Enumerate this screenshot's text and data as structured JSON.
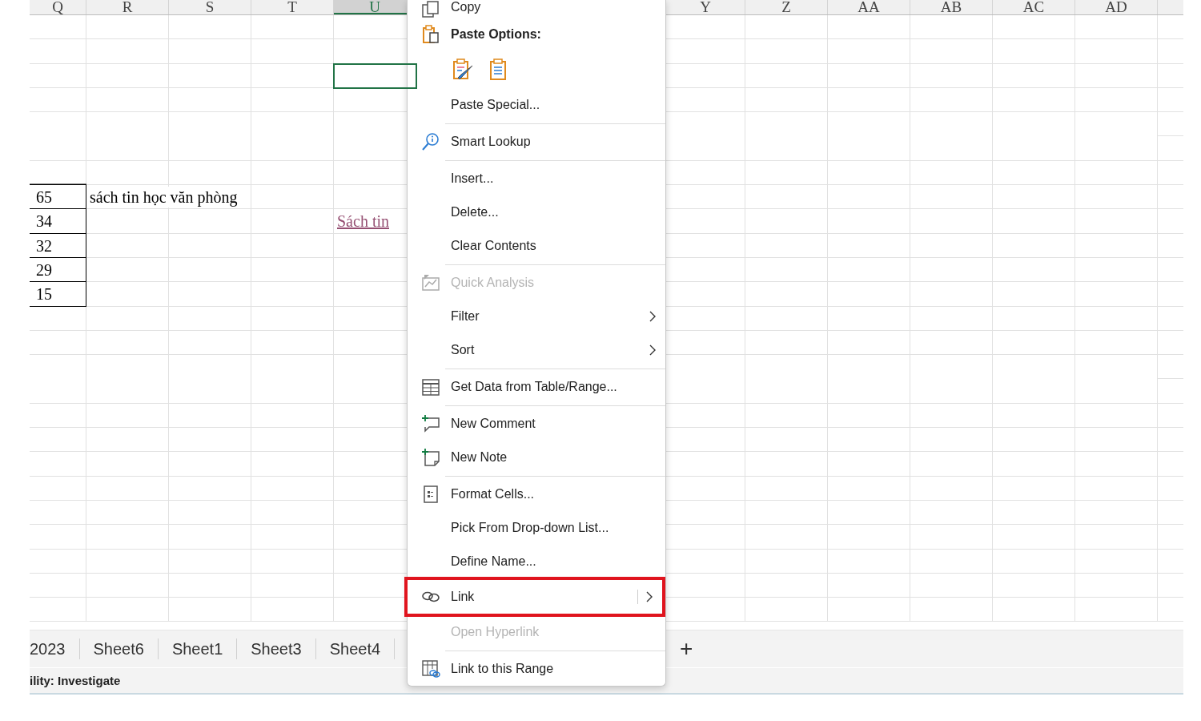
{
  "sheet": {
    "columns": [
      "Q",
      "R",
      "S",
      "T",
      "U",
      "Y",
      "Z",
      "AA",
      "AB",
      "AC",
      "AD"
    ],
    "rows": [
      {},
      {},
      {
        "cells": [
          null,
          null,
          null,
          null,
          {
            "kind": "plain",
            "selected": true
          }
        ]
      },
      {},
      {},
      {},
      {},
      {
        "cells": [
          {
            "kind": "bordered",
            "text": "65"
          },
          {
            "kind": "plain",
            "text": "sách tin học văn phòng"
          }
        ]
      },
      {
        "cells": [
          {
            "kind": "bordered",
            "text": "34"
          },
          null,
          null,
          null,
          {
            "kind": "plain",
            "text": "Sách tin",
            "link": true
          }
        ]
      },
      {
        "cells": [
          {
            "kind": "bordered",
            "text": "32"
          }
        ]
      },
      {
        "cells": [
          {
            "kind": "bordered",
            "text": "29"
          }
        ]
      },
      {
        "cells": [
          {
            "kind": "bordered",
            "text": "15"
          }
        ]
      },
      {},
      {},
      {},
      {},
      {},
      {},
      {},
      {},
      {},
      {},
      {},
      {},
      {}
    ]
  },
  "sheet_tabs": {
    "tabs": [
      "2023",
      "Sheet6",
      "Sheet1",
      "Sheet3",
      "Sheet4"
    ],
    "add_button": "+"
  },
  "status_bar": {
    "text": "ility: Investigate"
  },
  "context_menu": {
    "items": [
      {
        "kind": "command",
        "label": "Copy",
        "disabled": false
      },
      {
        "kind": "header",
        "label": "Paste Options:"
      },
      {
        "kind": "paste-icons"
      },
      {
        "kind": "command",
        "label": "Paste Special...",
        "disabled": false
      },
      {
        "kind": "separator"
      },
      {
        "kind": "command",
        "label": "Smart Lookup",
        "disabled": false
      },
      {
        "kind": "separator"
      },
      {
        "kind": "command",
        "label": "Insert...",
        "disabled": false
      },
      {
        "kind": "command",
        "label": "Delete...",
        "disabled": false
      },
      {
        "kind": "command",
        "label": "Clear Contents",
        "disabled": false
      },
      {
        "kind": "separator"
      },
      {
        "kind": "command",
        "label": "Quick Analysis",
        "disabled": true
      },
      {
        "kind": "submenu",
        "label": "Filter",
        "disabled": false,
        "highlighted": false
      },
      {
        "kind": "submenu",
        "label": "Sort",
        "disabled": false,
        "highlighted": false
      },
      {
        "kind": "separator"
      },
      {
        "kind": "command",
        "label": "Get Data from Table/Range...",
        "disabled": false
      },
      {
        "kind": "separator"
      },
      {
        "kind": "command",
        "label": "New Comment",
        "disabled": false
      },
      {
        "kind": "command",
        "label": "New Note",
        "disabled": false
      },
      {
        "kind": "separator"
      },
      {
        "kind": "command",
        "label": "Format Cells...",
        "disabled": false
      },
      {
        "kind": "command",
        "label": "Pick From Drop-down List...",
        "disabled": false
      },
      {
        "kind": "command",
        "label": "Define Name...",
        "disabled": false
      },
      {
        "kind": "submenu",
        "label": "Link",
        "disabled": false,
        "highlighted": true
      },
      {
        "kind": "command",
        "label": "Open Hyperlink",
        "disabled": true
      },
      {
        "kind": "separator"
      },
      {
        "kind": "command",
        "label": "Link to this Range",
        "disabled": false
      }
    ]
  }
}
